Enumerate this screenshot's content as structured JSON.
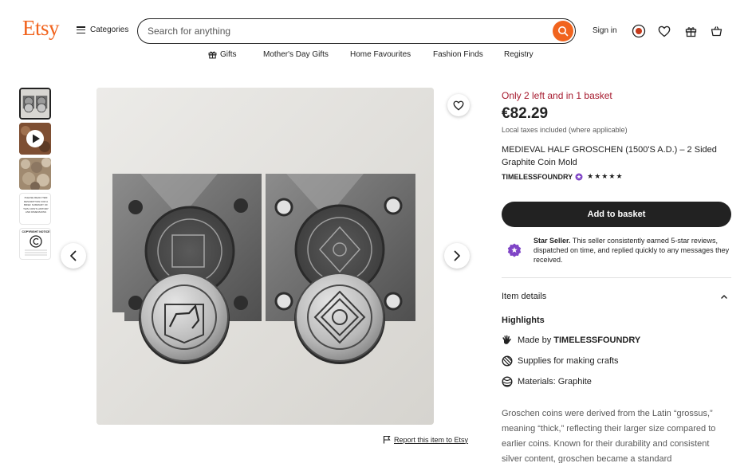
{
  "header": {
    "logo": "Etsy",
    "categories": "Categories",
    "search_placeholder": "Search for anything",
    "signin": "Sign in"
  },
  "subnav": {
    "items": [
      "Gifts",
      "Mother's Day Gifts",
      "Home Favourites",
      "Fashion Finds",
      "Registry"
    ]
  },
  "thumbnails": {
    "count": 5,
    "selected_index": 0,
    "thumb3_text": "PLEASE READ ITEM DESCRIPTION FOR A BRIEF SUMMARY OF THIS COIN'S HISTORY AND DIMENSIONS",
    "thumb4_title": "COPYRIGHT NOTICE"
  },
  "product": {
    "stock": "Only 2 left and in 1 basket",
    "price": "€82.29",
    "taxes": "Local taxes included (where applicable)",
    "title": "MEDIEVAL HALF GROSCHEN (1500'S A.D.) – 2 Sided Graphite Coin Mold",
    "seller": "TIMELESSFOUNDRY",
    "rating": 5,
    "stars": "★★★★★",
    "add_to_basket": "Add to basket"
  },
  "star_seller": {
    "label": "Star Seller.",
    "text": " This seller consistently earned 5-star reviews, dispatched on time, and replied quickly to any messages they received."
  },
  "item_details": {
    "heading": "Item details",
    "highlights": "Highlights",
    "made_by_prefix": "Made by ",
    "made_by_name": "TIMELESSFOUNDRY",
    "supplies": "Supplies for making crafts",
    "materials": "Materials: Graphite"
  },
  "description": "Groschen coins were derived from the Latin “grossus,” meaning “thick,” reflecting their larger size compared to earlier coins. Known for their durability and consistent silver content, groschen became a standard",
  "report": "Report this item to Etsy",
  "colors": {
    "brand": "#f1641e",
    "stock_red": "#a61a2e",
    "dark": "#222222",
    "star_seller_purple": "#7f44c6"
  }
}
